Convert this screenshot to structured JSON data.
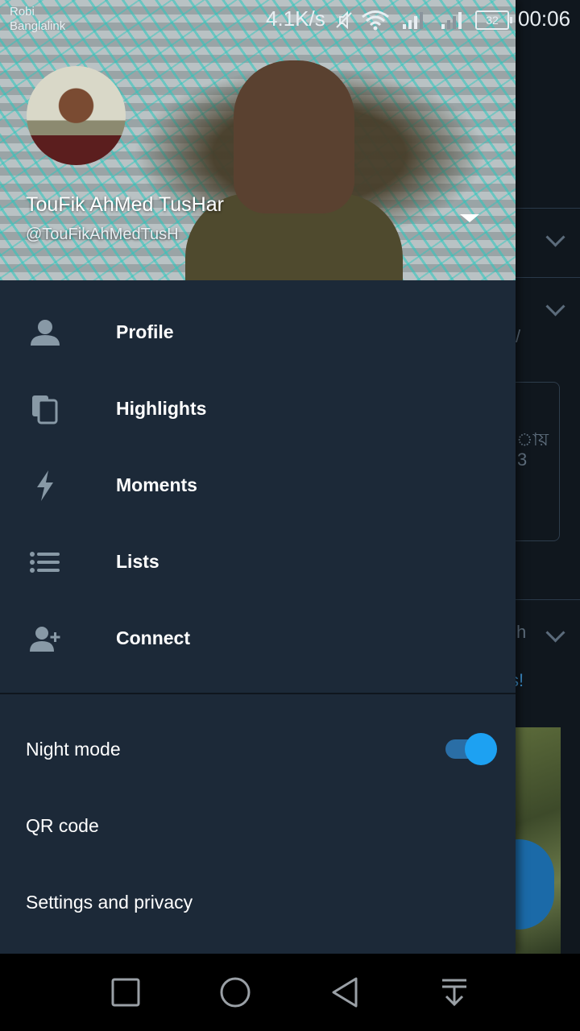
{
  "status_bar": {
    "carrier_line1": "Robi",
    "carrier_line2": "Banglalink",
    "network_speed": "4.1K/s",
    "battery": "32",
    "time": "00:06",
    "icons": [
      "vibrate-mute-icon",
      "wifi-icon",
      "signal-icon",
      "signal-icon-2"
    ]
  },
  "drawer": {
    "account": {
      "name": "TouFik AhMed TusHar",
      "handle": "@TouFikAhMedTusH"
    },
    "menu": [
      {
        "label": "Profile",
        "icon": "person-icon"
      },
      {
        "label": "Highlights",
        "icon": "highlights-icon"
      },
      {
        "label": "Moments",
        "icon": "lightning-icon"
      },
      {
        "label": "Lists",
        "icon": "list-icon"
      },
      {
        "label": "Connect",
        "icon": "person-add-icon"
      }
    ],
    "settings": [
      {
        "label": "Night mode",
        "toggle": true,
        "toggle_on": true
      },
      {
        "label": "QR code"
      },
      {
        "label": "Settings and privacy"
      }
    ]
  },
  "background": {
    "partial_text_1": "ায়",
    "partial_text_2": "3",
    "partial_text_3": "/",
    "partial_text_4": "h",
    "partial_text_5": "s!"
  },
  "nav_bar": {
    "buttons": [
      "recent-apps-icon",
      "home-icon",
      "back-icon",
      "notification-pull-icon"
    ]
  },
  "colors": {
    "drawer_bg": "#1c2938",
    "accent": "#1da1f2",
    "text": "#ffffff"
  }
}
